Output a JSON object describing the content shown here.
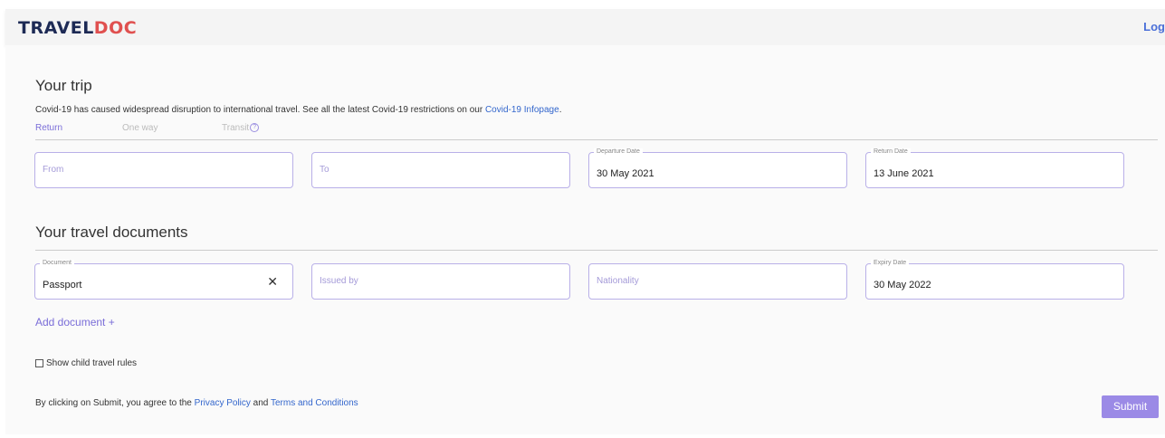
{
  "header": {
    "logo_main": "TRAVEL",
    "logo_accent": "DOC",
    "login_label": "Log"
  },
  "trip": {
    "heading": "Your trip",
    "notice_text": "Covid-19 has caused widespread disruption to international travel. See all the latest Covid-19 restrictions on our ",
    "notice_link": "Covid-19 Infopage",
    "notice_end": ".",
    "tabs": [
      {
        "label": "Return",
        "active": true
      },
      {
        "label": "One way",
        "active": false
      },
      {
        "label": "Transit",
        "active": false
      }
    ],
    "help_icon": "?",
    "from_placeholder": "From",
    "to_placeholder": "To",
    "departure_label": "Departure Date",
    "departure_value": "30 May 2021",
    "return_label": "Return Date",
    "return_value": "13 June 2021"
  },
  "documents": {
    "heading": "Your travel documents",
    "document_label": "Document",
    "document_value": "Passport",
    "clear_icon": "✕",
    "issued_by_placeholder": "Issued by",
    "nationality_placeholder": "Nationality",
    "expiry_label": "Expiry Date",
    "expiry_value": "30 May 2022",
    "add_document_label": "Add document +"
  },
  "footer": {
    "child_rules_label": "Show child travel rules",
    "agree_text": "By clicking on Submit, you agree to the ",
    "privacy_link": "Privacy Policy",
    "and_text": " and ",
    "terms_link": "Terms and Conditions",
    "submit_label": "Submit"
  },
  "colors": {
    "accent": "#7a6dd8",
    "field_border": "#b9b0e8",
    "link": "#3366cc",
    "submit_bg": "#9b8ae6",
    "logo": "#1d2a55"
  }
}
